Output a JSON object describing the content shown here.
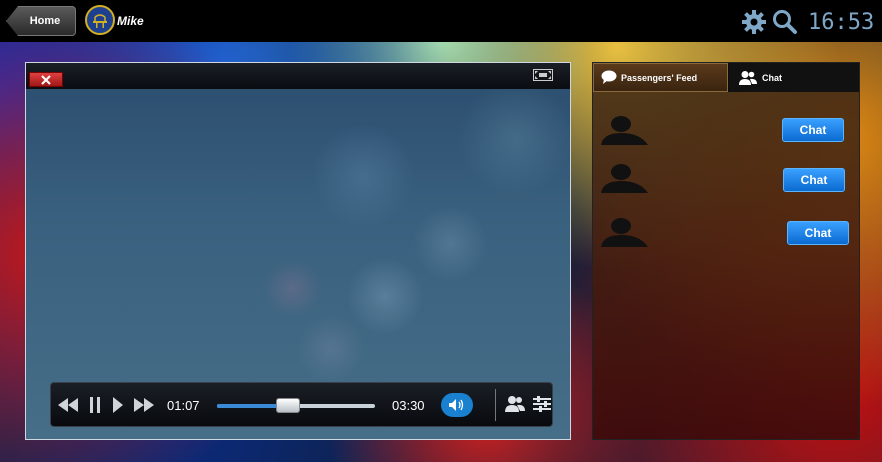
{
  "topbar": {
    "home_label": "Home",
    "user_name": "Mike",
    "clock": "16:53",
    "icons": [
      "gear-icon",
      "search-icon",
      "team-logo-avatar"
    ]
  },
  "player": {
    "current_time": "01:07",
    "total_time": "03:30",
    "progress": 0.45,
    "icons": [
      "close-icon",
      "fullscreen-icon",
      "rewind-icon",
      "pause-icon",
      "play-icon",
      "fast-forward-icon",
      "volume-icon",
      "users-icon",
      "settings-list-icon"
    ]
  },
  "side_panel": {
    "tabs": [
      {
        "label": "Passengers' Feed",
        "icon": "speech-bubble-icon",
        "active": true
      },
      {
        "label": "Chat",
        "icon": "users-icon",
        "active": false
      }
    ],
    "passengers": [
      {
        "chat_label": "Chat"
      },
      {
        "chat_label": "Chat"
      },
      {
        "chat_label": "Chat"
      }
    ]
  },
  "colors": {
    "accent_blue": "#1a80d0",
    "close_red": "#c82020",
    "clock_color": "#7fa7c8"
  }
}
